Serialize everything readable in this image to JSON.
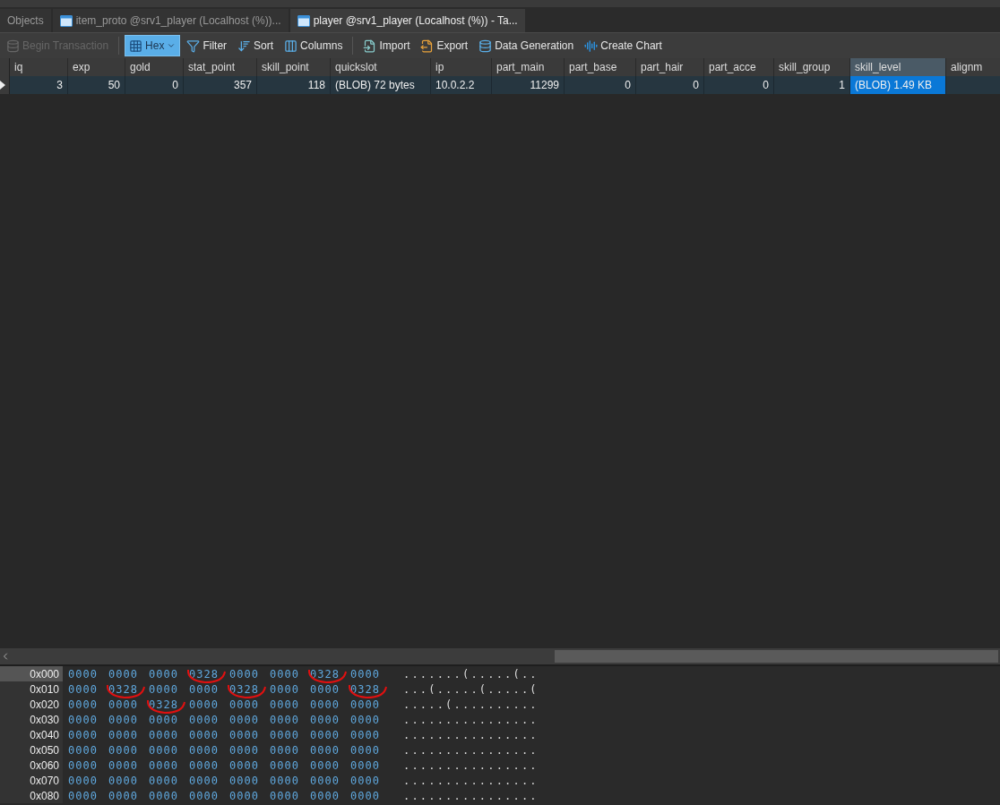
{
  "tabs": [
    {
      "label": "Objects",
      "kind": "plain",
      "selected": false
    },
    {
      "label": "item_proto @srv1_player (Localhost (%))...",
      "kind": "table",
      "selected": false
    },
    {
      "label": "player @srv1_player (Localhost (%)) - Ta...",
      "kind": "table",
      "selected": true
    }
  ],
  "toolbar": [
    {
      "label": "Begin Transaction",
      "kind": "transaction",
      "disabled": true,
      "on": false
    },
    {
      "label": "Hex",
      "kind": "hex",
      "disabled": false,
      "on": true
    },
    {
      "label": "Filter",
      "kind": "filter",
      "disabled": false,
      "on": false
    },
    {
      "label": "Sort",
      "kind": "sort",
      "disabled": false,
      "on": false
    },
    {
      "label": "Columns",
      "kind": "columns",
      "disabled": false,
      "on": false
    },
    {
      "label": "Import",
      "kind": "import",
      "disabled": false,
      "on": false
    },
    {
      "label": "Export",
      "kind": "export",
      "disabled": false,
      "on": false
    },
    {
      "label": "Data Generation",
      "kind": "datagen",
      "disabled": false,
      "on": false
    },
    {
      "label": "Create Chart",
      "kind": "chart",
      "disabled": false,
      "on": false
    }
  ],
  "table": {
    "columns": [
      {
        "label": "iq",
        "selected": false
      },
      {
        "label": "exp",
        "selected": false
      },
      {
        "label": "gold",
        "selected": false
      },
      {
        "label": "stat_point",
        "selected": false
      },
      {
        "label": "skill_point",
        "selected": false
      },
      {
        "label": "quickslot",
        "selected": false
      },
      {
        "label": "ip",
        "selected": false
      },
      {
        "label": "part_main",
        "selected": false
      },
      {
        "label": "part_base",
        "selected": false
      },
      {
        "label": "part_hair",
        "selected": false
      },
      {
        "label": "part_acce",
        "selected": false
      },
      {
        "label": "skill_group",
        "selected": false
      },
      {
        "label": "skill_level",
        "selected": true
      },
      {
        "label": "alignm",
        "selected": false
      }
    ],
    "rows": [
      {
        "selected": true,
        "cells": [
          "3",
          "50",
          "0",
          "357",
          "118",
          "(BLOB) 72 bytes",
          "10.0.2.2",
          "11299",
          "0",
          "0",
          "0",
          "1",
          "(BLOB) 1.49 KB",
          null
        ]
      }
    ]
  },
  "hex": {
    "rows": [
      {
        "offset": "0x000",
        "selected": true,
        "words": [
          {
            "text": "0000",
            "marked": false
          },
          {
            "text": "0000",
            "marked": false
          },
          {
            "text": "0000",
            "marked": false
          },
          {
            "text": "0328",
            "marked": true
          },
          {
            "text": "0000",
            "marked": false
          },
          {
            "text": "0000",
            "marked": false
          },
          {
            "text": "0328",
            "marked": true
          },
          {
            "text": "0000",
            "marked": false
          }
        ],
        "ascii": ".......(.....(.."
      },
      {
        "offset": "0x010",
        "selected": false,
        "words": [
          {
            "text": "0000",
            "marked": false
          },
          {
            "text": "0328",
            "marked": true
          },
          {
            "text": "0000",
            "marked": false
          },
          {
            "text": "0000",
            "marked": false
          },
          {
            "text": "0328",
            "marked": true
          },
          {
            "text": "0000",
            "marked": false
          },
          {
            "text": "0000",
            "marked": false
          },
          {
            "text": "0328",
            "marked": true
          }
        ],
        "ascii": "...(.....(.....("
      },
      {
        "offset": "0x020",
        "selected": false,
        "words": [
          {
            "text": "0000",
            "marked": false
          },
          {
            "text": "0000",
            "marked": false
          },
          {
            "text": "0328",
            "marked": true
          },
          {
            "text": "0000",
            "marked": false
          },
          {
            "text": "0000",
            "marked": false
          },
          {
            "text": "0000",
            "marked": false
          },
          {
            "text": "0000",
            "marked": false
          },
          {
            "text": "0000",
            "marked": false
          }
        ],
        "ascii": ".....(.........."
      },
      {
        "offset": "0x030",
        "selected": false,
        "words": [
          {
            "text": "0000",
            "marked": false
          },
          {
            "text": "0000",
            "marked": false
          },
          {
            "text": "0000",
            "marked": false
          },
          {
            "text": "0000",
            "marked": false
          },
          {
            "text": "0000",
            "marked": false
          },
          {
            "text": "0000",
            "marked": false
          },
          {
            "text": "0000",
            "marked": false
          },
          {
            "text": "0000",
            "marked": false
          }
        ],
        "ascii": "................"
      },
      {
        "offset": "0x040",
        "selected": false,
        "words": [
          {
            "text": "0000",
            "marked": false
          },
          {
            "text": "0000",
            "marked": false
          },
          {
            "text": "0000",
            "marked": false
          },
          {
            "text": "0000",
            "marked": false
          },
          {
            "text": "0000",
            "marked": false
          },
          {
            "text": "0000",
            "marked": false
          },
          {
            "text": "0000",
            "marked": false
          },
          {
            "text": "0000",
            "marked": false
          }
        ],
        "ascii": "................"
      },
      {
        "offset": "0x050",
        "selected": false,
        "words": [
          {
            "text": "0000",
            "marked": false
          },
          {
            "text": "0000",
            "marked": false
          },
          {
            "text": "0000",
            "marked": false
          },
          {
            "text": "0000",
            "marked": false
          },
          {
            "text": "0000",
            "marked": false
          },
          {
            "text": "0000",
            "marked": false
          },
          {
            "text": "0000",
            "marked": false
          },
          {
            "text": "0000",
            "marked": false
          }
        ],
        "ascii": "................"
      },
      {
        "offset": "0x060",
        "selected": false,
        "words": [
          {
            "text": "0000",
            "marked": false
          },
          {
            "text": "0000",
            "marked": false
          },
          {
            "text": "0000",
            "marked": false
          },
          {
            "text": "0000",
            "marked": false
          },
          {
            "text": "0000",
            "marked": false
          },
          {
            "text": "0000",
            "marked": false
          },
          {
            "text": "0000",
            "marked": false
          },
          {
            "text": "0000",
            "marked": false
          }
        ],
        "ascii": "................"
      },
      {
        "offset": "0x070",
        "selected": false,
        "words": [
          {
            "text": "0000",
            "marked": false
          },
          {
            "text": "0000",
            "marked": false
          },
          {
            "text": "0000",
            "marked": false
          },
          {
            "text": "0000",
            "marked": false
          },
          {
            "text": "0000",
            "marked": false
          },
          {
            "text": "0000",
            "marked": false
          },
          {
            "text": "0000",
            "marked": false
          },
          {
            "text": "0000",
            "marked": false
          }
        ],
        "ascii": "................"
      },
      {
        "offset": "0x080",
        "selected": false,
        "words": [
          {
            "text": "0000",
            "marked": false
          },
          {
            "text": "0000",
            "marked": false
          },
          {
            "text": "0000",
            "marked": false
          },
          {
            "text": "0000",
            "marked": false
          },
          {
            "text": "0000",
            "marked": false
          },
          {
            "text": "0000",
            "marked": false
          },
          {
            "text": "0000",
            "marked": false
          },
          {
            "text": "0000",
            "marked": false
          }
        ],
        "ascii": "................"
      }
    ]
  }
}
